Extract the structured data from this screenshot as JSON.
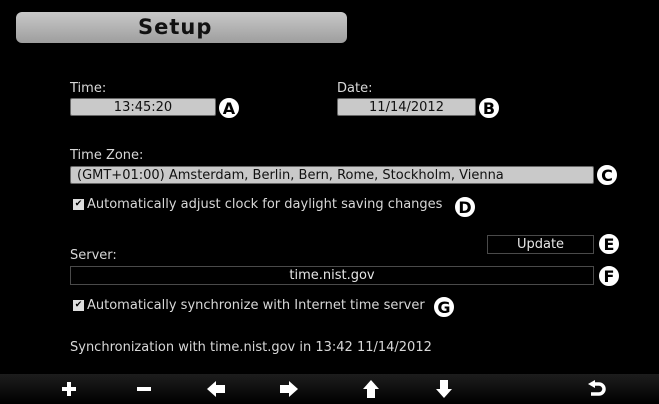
{
  "header": {
    "title": "Setup"
  },
  "time": {
    "label": "Time:",
    "value": "13:45:20",
    "badge": "A"
  },
  "date": {
    "label": "Date:",
    "value": "11/14/2012",
    "badge": "B"
  },
  "timezone": {
    "label": "Time Zone:",
    "value": "(GMT+01:00) Amsterdam, Berlin, Bern, Rome, Stockholm, Vienna",
    "badge": "C"
  },
  "dst": {
    "label": "Automatically adjust clock for daylight saving changes",
    "checked": true,
    "badge": "D"
  },
  "update": {
    "label": "Update",
    "badge": "E"
  },
  "server": {
    "label": "Server:",
    "value": "time.nist.gov",
    "badge": "F"
  },
  "sync": {
    "label": "Automatically synchronize with Internet time server",
    "checked": true,
    "badge": "G"
  },
  "status": {
    "text": "Synchronization with time.nist.gov in 13:42 11/14/2012"
  },
  "toolbar": {
    "buttons": [
      {
        "icon": "plus-icon"
      },
      {
        "icon": "minus-icon"
      },
      {
        "icon": "arrow-left-icon"
      },
      {
        "icon": "arrow-right-icon"
      },
      {
        "icon": "arrow-up-icon"
      },
      {
        "icon": "arrow-down-icon"
      },
      {
        "icon": "return-icon"
      }
    ]
  }
}
